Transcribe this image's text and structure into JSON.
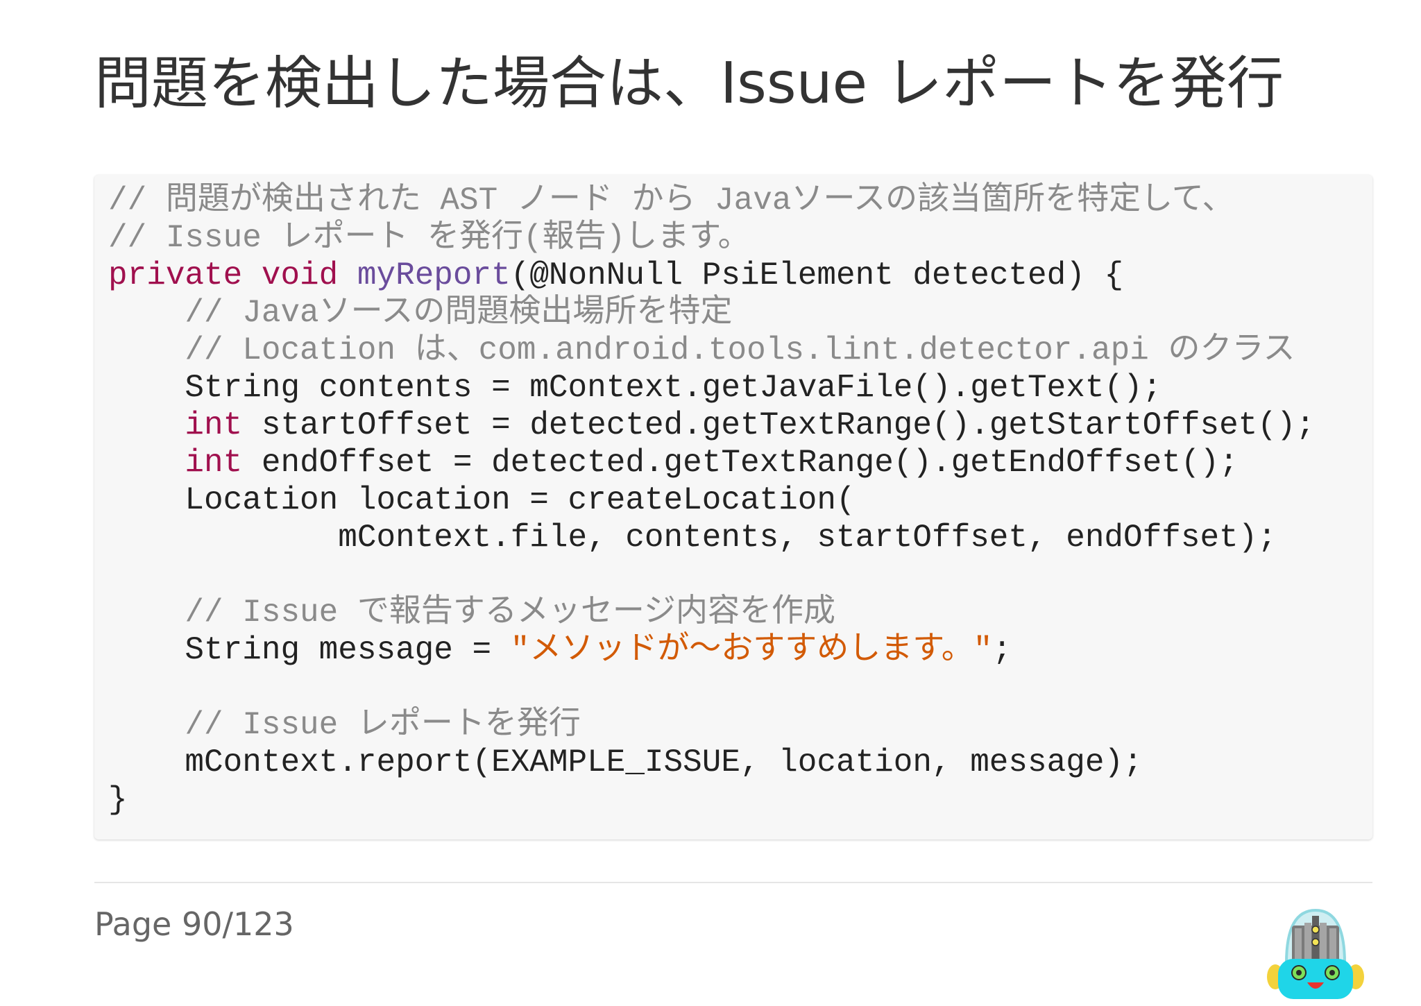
{
  "slide": {
    "title": "問題を検出した場合は、Issue レポートを発行",
    "page_label": "Page 90/123"
  },
  "code_block": {
    "lines": [
      [
        {
          "type": "comment",
          "text": "// 問題が検出された AST ノード から Javaソースの該当箇所を特定して、"
        }
      ],
      [
        {
          "type": "comment",
          "text": "// Issue レポート を発行(報告)します。"
        }
      ],
      [
        {
          "type": "keyword",
          "text": "private"
        },
        {
          "type": "plain",
          "text": " "
        },
        {
          "type": "keyword",
          "text": "void"
        },
        {
          "type": "plain",
          "text": " "
        },
        {
          "type": "func",
          "text": "myReport"
        },
        {
          "type": "plain",
          "text": "(@NonNull PsiElement detected) {"
        }
      ],
      [
        {
          "type": "plain",
          "text": "    "
        },
        {
          "type": "comment",
          "text": "// Javaソースの問題検出場所を特定"
        }
      ],
      [
        {
          "type": "plain",
          "text": "    "
        },
        {
          "type": "comment",
          "text": "// Location は、com.android.tools.lint.detector.api のクラス"
        }
      ],
      [
        {
          "type": "plain",
          "text": "    String contents = mContext.getJavaFile().getText();"
        }
      ],
      [
        {
          "type": "plain",
          "text": "    "
        },
        {
          "type": "keyword",
          "text": "int"
        },
        {
          "type": "plain",
          "text": " startOffset = detected.getTextRange().getStartOffset();"
        }
      ],
      [
        {
          "type": "plain",
          "text": "    "
        },
        {
          "type": "keyword",
          "text": "int"
        },
        {
          "type": "plain",
          "text": " endOffset = detected.getTextRange().getEndOffset();"
        }
      ],
      [
        {
          "type": "plain",
          "text": "    Location location = createLocation("
        }
      ],
      [
        {
          "type": "plain",
          "text": "            mContext.file, contents, startOffset, endOffset);"
        }
      ],
      [
        {
          "type": "plain",
          "text": ""
        }
      ],
      [
        {
          "type": "plain",
          "text": "    "
        },
        {
          "type": "comment",
          "text": "// Issue で報告するメッセージ内容を作成"
        }
      ],
      [
        {
          "type": "plain",
          "text": "    String message = "
        },
        {
          "type": "string",
          "text": "\"メソッドが〜おすすめします。\""
        },
        {
          "type": "plain",
          "text": ";"
        }
      ],
      [
        {
          "type": "plain",
          "text": ""
        }
      ],
      [
        {
          "type": "plain",
          "text": "    "
        },
        {
          "type": "comment",
          "text": "// Issue レポートを発行"
        }
      ],
      [
        {
          "type": "plain",
          "text": "    mContext.report(EXAMPLE_ISSUE, location, message);"
        }
      ],
      [
        {
          "type": "plain",
          "text": "}"
        }
      ]
    ]
  },
  "colors": {
    "comment": "#8a8a8a",
    "keyword": "#a0104e",
    "function": "#6a4c9c",
    "string": "#d25a05",
    "plain": "#222222",
    "title": "#333333",
    "code_background": "#f7f7f7"
  },
  "icons": {
    "mascot": "android-robot-mascot-icon"
  }
}
